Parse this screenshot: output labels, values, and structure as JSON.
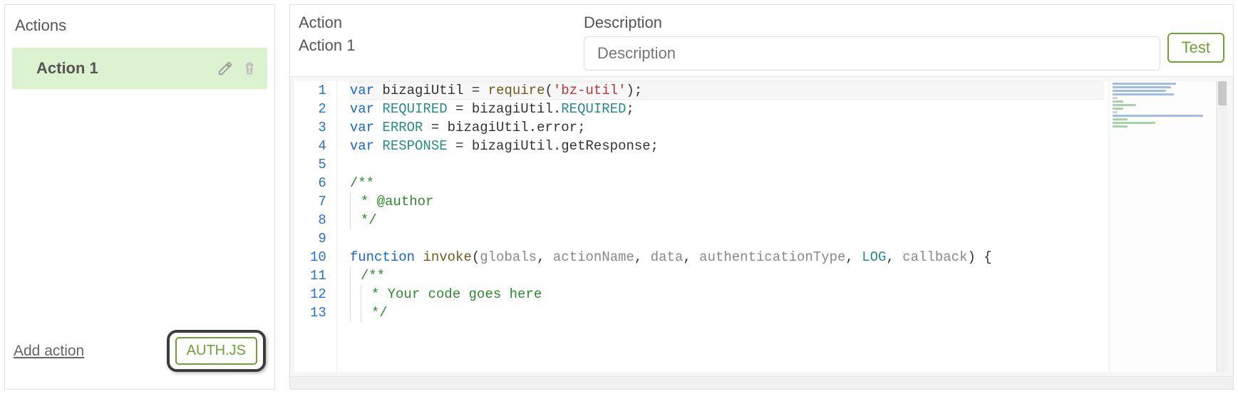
{
  "sidebar": {
    "heading": "Actions",
    "items": [
      {
        "label": "Action 1"
      }
    ],
    "add_action_label": "Add action",
    "authjs_label": "AUTH.JS"
  },
  "editor": {
    "action_label": "Action",
    "action_name": "Action 1",
    "description_label": "Description",
    "description_placeholder": "Description",
    "description_value": "",
    "test_label": "Test"
  },
  "code": {
    "lines": [
      {
        "n": 1,
        "tokens": [
          {
            "t": "var ",
            "c": "kw"
          },
          {
            "t": "bizagiUtil",
            "c": ""
          },
          {
            "t": " = ",
            "c": ""
          },
          {
            "t": "require",
            "c": "fn"
          },
          {
            "t": "(",
            "c": ""
          },
          {
            "t": "'bz-util'",
            "c": "str"
          },
          {
            "t": ");",
            "c": ""
          }
        ]
      },
      {
        "n": 2,
        "tokens": [
          {
            "t": "var ",
            "c": "kw"
          },
          {
            "t": "REQUIRED",
            "c": "const"
          },
          {
            "t": " = bizagiUtil.",
            "c": ""
          },
          {
            "t": "REQUIRED",
            "c": "const"
          },
          {
            "t": ";",
            "c": ""
          }
        ]
      },
      {
        "n": 3,
        "tokens": [
          {
            "t": "var ",
            "c": "kw"
          },
          {
            "t": "ERROR",
            "c": "const"
          },
          {
            "t": " = bizagiUtil.error;",
            "c": ""
          }
        ]
      },
      {
        "n": 4,
        "tokens": [
          {
            "t": "var ",
            "c": "kw"
          },
          {
            "t": "RESPONSE",
            "c": "const"
          },
          {
            "t": " = bizagiUtil.getResponse;",
            "c": ""
          }
        ]
      },
      {
        "n": 5,
        "tokens": [
          {
            "t": "",
            "c": ""
          }
        ]
      },
      {
        "n": 6,
        "tokens": [
          {
            "t": "/**",
            "c": "cmt"
          }
        ]
      },
      {
        "n": 7,
        "indent": true,
        "tokens": [
          {
            "t": "* @author",
            "c": "cmt"
          }
        ]
      },
      {
        "n": 8,
        "indent": true,
        "tokens": [
          {
            "t": "*/",
            "c": "cmt"
          }
        ]
      },
      {
        "n": 9,
        "tokens": [
          {
            "t": "",
            "c": ""
          }
        ]
      },
      {
        "n": 10,
        "tokens": [
          {
            "t": "function ",
            "c": "kw"
          },
          {
            "t": "invoke",
            "c": "fn"
          },
          {
            "t": "(",
            "c": ""
          },
          {
            "t": "globals",
            "c": "param"
          },
          {
            "t": ", ",
            "c": ""
          },
          {
            "t": "actionName",
            "c": "param"
          },
          {
            "t": ", ",
            "c": ""
          },
          {
            "t": "data",
            "c": "param"
          },
          {
            "t": ", ",
            "c": ""
          },
          {
            "t": "authenticationType",
            "c": "param"
          },
          {
            "t": ", ",
            "c": ""
          },
          {
            "t": "LOG",
            "c": "log"
          },
          {
            "t": ", ",
            "c": ""
          },
          {
            "t": "callback",
            "c": "param"
          },
          {
            "t": ") {",
            "c": ""
          }
        ]
      },
      {
        "n": 11,
        "indent": true,
        "inner": true,
        "tokens": [
          {
            "t": "/**",
            "c": "cmt"
          }
        ]
      },
      {
        "n": 12,
        "indent": true,
        "inner": true,
        "guide2": true,
        "tokens": [
          {
            "t": "* Your code goes here",
            "c": "cmt"
          }
        ]
      },
      {
        "n": 13,
        "indent": true,
        "inner": true,
        "guide2": true,
        "tokens": [
          {
            "t": "*/",
            "c": "cmt"
          }
        ]
      }
    ]
  }
}
